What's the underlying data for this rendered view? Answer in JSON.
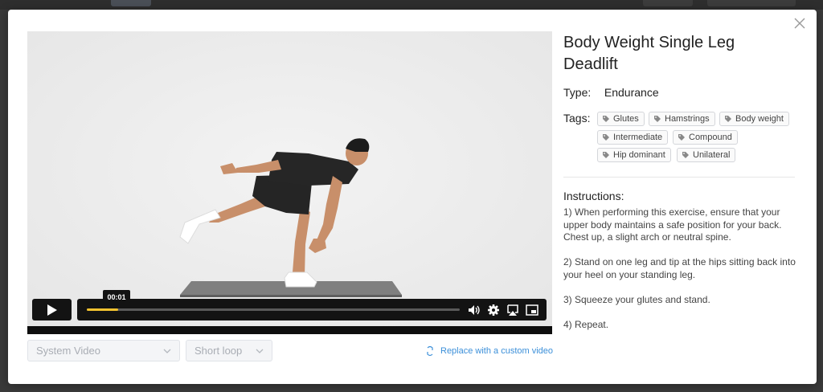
{
  "exercise": {
    "title": "Body Weight Single Leg Deadlift",
    "type_label": "Type:",
    "type_value": "Endurance",
    "tags_label": "Tags:",
    "tags": [
      "Glutes",
      "Hamstrings",
      "Body weight",
      "Intermediate",
      "Compound",
      "Hip dominant",
      "Unilateral"
    ],
    "instructions_title": "Instructions:",
    "instructions": [
      "1) When performing this exercise, ensure that your upper body maintains a safe position for your back. Chest up, a slight arch or neutral spine.",
      "2) Stand on one leg and tip at the hips sitting back into your heel on your standing leg.",
      "3) Squeeze your glutes and stand.",
      "4) Repeat."
    ]
  },
  "player": {
    "current_time": "00:01",
    "progress_fraction": 0.085,
    "colors": {
      "progress": "#f2c230",
      "controls_bg": "#131313"
    },
    "icons": [
      "play-icon",
      "volume-icon",
      "settings-icon",
      "airplay-icon",
      "pip-icon"
    ]
  },
  "video_options": {
    "source_select": "System Video",
    "loop_select": "Short loop",
    "replace_link": "Replace with a custom video"
  },
  "colors": {
    "link": "#3b8fd9",
    "accent": "#f2c230"
  }
}
